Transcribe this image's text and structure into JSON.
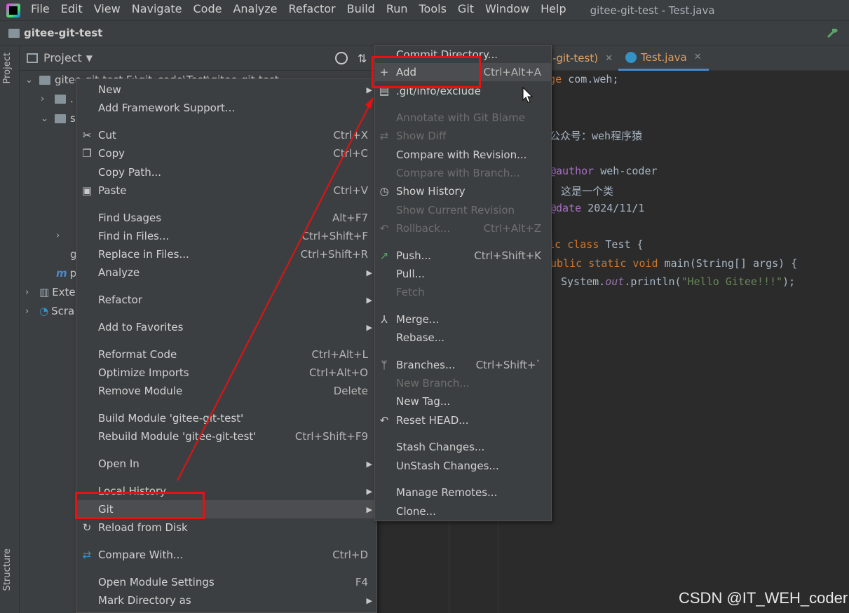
{
  "app": {
    "menu": [
      "File",
      "Edit",
      "View",
      "Navigate",
      "Code",
      "Analyze",
      "Refactor",
      "Build",
      "Run",
      "Tools",
      "Git",
      "Window",
      "Help"
    ],
    "window_title": "gitee-git-test - Test.java"
  },
  "navbar": {
    "project": "gitee-git-test"
  },
  "stripe": {
    "project": "Project",
    "structure": "Structure"
  },
  "project_panel": {
    "title": "Project",
    "tree": [
      {
        "label": "gitee-git-test  F:\\git_code\\Test\\gitee-git-test"
      },
      {
        "label": "."
      },
      {
        "label": "s"
      },
      {
        "label": "g"
      },
      {
        "label": "p"
      },
      {
        "label": "Exte"
      },
      {
        "label": "Scra"
      }
    ]
  },
  "editor": {
    "tabs": [
      {
        "label": "-git-test)"
      },
      {
        "label": "Test.java"
      }
    ],
    "code": {
      "l1a": "package",
      "l1b": " com.weh;",
      "l2": "公众号：weh程序猿",
      "l3a": "@author",
      "l3b": " weh-coder",
      "l4": "这是一个类",
      "l5a": "@date",
      "l5b": " 2024/11/1",
      "l6a": "public class",
      "l6b": " Test {",
      "l7a": "public static void",
      "l7b": " main(String[] args) {",
      "l8a": "System.",
      "l8b": "out",
      "l8c": ".println(",
      "l8d": "\"Hello Gitee!!!\"",
      "l8e": ");"
    }
  },
  "context_menu": {
    "items": [
      {
        "label": "New",
        "shortcut": "",
        "icon": "",
        "submenu": true
      },
      {
        "label": "Add Framework Support...",
        "shortcut": "",
        "icon": ""
      },
      {
        "label": "Cut",
        "shortcut": "Ctrl+X",
        "icon": "scissors-icon"
      },
      {
        "label": "Copy",
        "shortcut": "Ctrl+C",
        "icon": "copy-icon"
      },
      {
        "label": "Copy Path...",
        "shortcut": "",
        "icon": ""
      },
      {
        "label": "Paste",
        "shortcut": "Ctrl+V",
        "icon": "paste-icon"
      },
      {
        "label": "Find Usages",
        "shortcut": "Alt+F7",
        "icon": ""
      },
      {
        "label": "Find in Files...",
        "shortcut": "Ctrl+Shift+F",
        "icon": ""
      },
      {
        "label": "Replace in Files...",
        "shortcut": "Ctrl+Shift+R",
        "icon": ""
      },
      {
        "label": "Analyze",
        "shortcut": "",
        "icon": "",
        "submenu": true
      },
      {
        "label": "Refactor",
        "shortcut": "",
        "icon": "",
        "submenu": true
      },
      {
        "label": "Add to Favorites",
        "shortcut": "",
        "icon": "",
        "submenu": true
      },
      {
        "label": "Reformat Code",
        "shortcut": "Ctrl+Alt+L",
        "icon": ""
      },
      {
        "label": "Optimize Imports",
        "shortcut": "Ctrl+Alt+O",
        "icon": ""
      },
      {
        "label": "Remove Module",
        "shortcut": "Delete",
        "icon": ""
      },
      {
        "label": "Build Module 'gitee-git-test'",
        "shortcut": "",
        "icon": ""
      },
      {
        "label": "Rebuild Module 'gitee-git-test'",
        "shortcut": "Ctrl+Shift+F9",
        "icon": ""
      },
      {
        "label": "Open In",
        "shortcut": "",
        "icon": "",
        "submenu": true
      },
      {
        "label": "Local History",
        "shortcut": "",
        "icon": "",
        "submenu": true
      },
      {
        "label": "Git",
        "shortcut": "",
        "icon": "",
        "submenu": true
      },
      {
        "label": "Reload from Disk",
        "shortcut": "",
        "icon": "reload-icon"
      },
      {
        "label": "Compare With...",
        "shortcut": "Ctrl+D",
        "icon": "compare-icon"
      },
      {
        "label": "Open Module Settings",
        "shortcut": "F4",
        "icon": ""
      },
      {
        "label": "Mark Directory as",
        "shortcut": "",
        "icon": "",
        "submenu": true
      }
    ]
  },
  "git_menu": {
    "items": [
      {
        "label": "Commit Directory...",
        "shortcut": ""
      },
      {
        "label": "Add",
        "shortcut": "Ctrl+Alt+A"
      },
      {
        "label": ".git/info/exclude",
        "shortcut": ""
      },
      {
        "label": "Annotate with Git Blame",
        "shortcut": ""
      },
      {
        "label": "Show Diff",
        "shortcut": ""
      },
      {
        "label": "Compare with Revision...",
        "shortcut": ""
      },
      {
        "label": "Compare with Branch...",
        "shortcut": ""
      },
      {
        "label": "Show History",
        "shortcut": ""
      },
      {
        "label": "Show Current Revision",
        "shortcut": ""
      },
      {
        "label": "Rollback...",
        "shortcut": "Ctrl+Alt+Z"
      },
      {
        "label": "Push...",
        "shortcut": "Ctrl+Shift+K"
      },
      {
        "label": "Pull...",
        "shortcut": ""
      },
      {
        "label": "Fetch",
        "shortcut": ""
      },
      {
        "label": "Merge...",
        "shortcut": ""
      },
      {
        "label": "Rebase...",
        "shortcut": ""
      },
      {
        "label": "Branches...",
        "shortcut": "Ctrl+Shift+`"
      },
      {
        "label": "New Branch...",
        "shortcut": ""
      },
      {
        "label": "New Tag...",
        "shortcut": ""
      },
      {
        "label": "Reset HEAD...",
        "shortcut": ""
      },
      {
        "label": "Stash Changes...",
        "shortcut": ""
      },
      {
        "label": "UnStash Changes...",
        "shortcut": ""
      },
      {
        "label": "Manage Remotes...",
        "shortcut": ""
      },
      {
        "label": "Clone...",
        "shortcut": ""
      }
    ]
  },
  "watermark": "CSDN @IT_WEH_coder",
  "colors": {
    "annotation": "#e81010",
    "accent": "#4a88c7",
    "push_icon": "#59a869"
  }
}
